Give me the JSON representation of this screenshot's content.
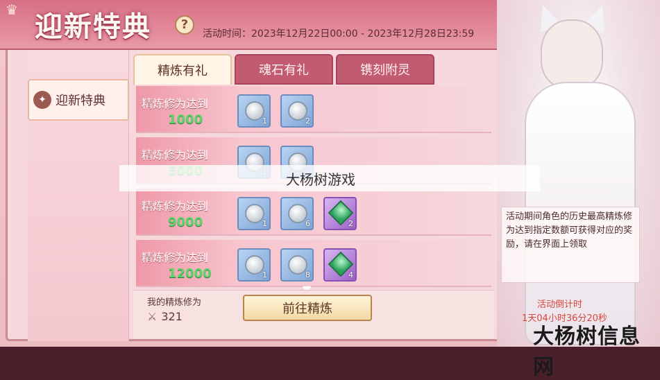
{
  "header": {
    "title": "迎新特典",
    "help_icon": "?",
    "time_label": "活动时间：2023年12月22日00:00 - 2023年12月28日23:59",
    "close_icon": "close-icon"
  },
  "sidebar": {
    "items": [
      {
        "label": "迎新特典",
        "icon": "emblem-icon"
      }
    ]
  },
  "tabs": [
    {
      "label": "精炼有礼",
      "active": true
    },
    {
      "label": "魂石有礼",
      "active": false
    },
    {
      "label": "镌刻附灵",
      "active": false
    }
  ],
  "rows": [
    {
      "label": "精炼修为达到",
      "value": "1000",
      "rewards": [
        {
          "type": "silver",
          "qty": "1"
        },
        {
          "type": "silver-stone",
          "qty": "2"
        }
      ]
    },
    {
      "label": "精炼修为达到",
      "value": "5000",
      "rewards": [
        {
          "type": "silver",
          "qty": "1"
        },
        {
          "type": "silver-stone",
          "qty": ""
        }
      ]
    },
    {
      "label": "精炼修为达到",
      "value": "9000",
      "rewards": [
        {
          "type": "silver",
          "qty": "1"
        },
        {
          "type": "silver-stone",
          "qty": "6"
        },
        {
          "type": "gem",
          "qty": "2"
        }
      ]
    },
    {
      "label": "精炼修为达到",
      "value": "12000",
      "rewards": [
        {
          "type": "silver",
          "qty": "1"
        },
        {
          "type": "silver-stone",
          "qty": "8"
        },
        {
          "type": "gem",
          "qty": "4"
        }
      ]
    }
  ],
  "bottom": {
    "my_label": "我的精炼修为",
    "my_value": "321",
    "go_button": "前往精炼"
  },
  "description": "活动期间角色的历史最高精炼修为达到指定数额可获得对应的奖励，请在界面上领取",
  "countdown": {
    "title": "活动倒计时",
    "value": "1天04小时36分20秒"
  },
  "watermark": "大杨树游戏",
  "brand": "大杨树信息网"
}
